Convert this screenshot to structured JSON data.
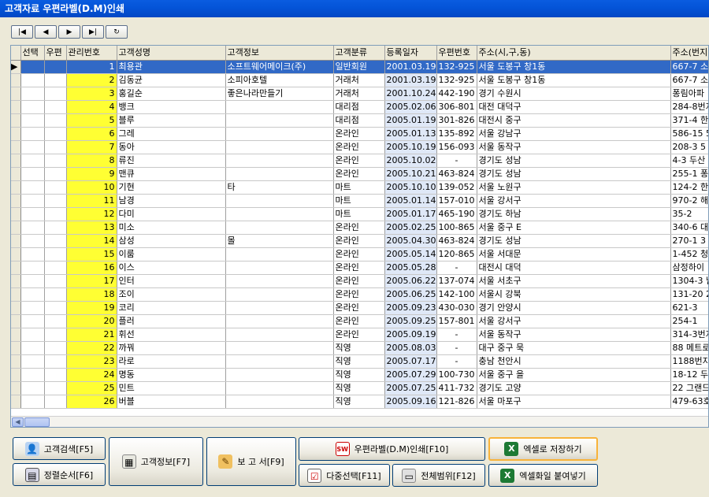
{
  "window": {
    "title": "고객자료 우편라벨(D.M)인쇄"
  },
  "navigator": [
    "|◀",
    "◀",
    "▶",
    "▶|",
    "↻"
  ],
  "grid": {
    "columns": [
      "선택",
      "우편",
      "관리번호",
      "고객성명",
      "고객정보",
      "고객분류",
      "등록일자",
      "우편번호",
      "주소(시,구,동)",
      "주소(번지"
    ],
    "rows": [
      [
        "",
        "",
        "1",
        "최용관",
        "소프트웨어메이크(주)",
        "일반회원",
        "2001.03.19",
        "132-925",
        "서울 도봉구 창1동",
        "667-7 소"
      ],
      [
        "",
        "",
        "2",
        "김동균",
        "소피아호텔",
        "거래처",
        "2001.03.19",
        "132-925",
        "서울 도봉구 창1동",
        "667-7 소"
      ],
      [
        "",
        "",
        "3",
        "홍길순",
        "좋은나라만들기",
        "거래처",
        "2001.10.24",
        "442-190",
        "경기 수원시",
        "퐁림아파"
      ],
      [
        "",
        "",
        "4",
        "뱅크",
        "",
        "대리점",
        "2005.02.06",
        "306-801",
        "대전 대덕구",
        "284-8번지"
      ],
      [
        "",
        "",
        "5",
        "블루",
        "",
        "대리점",
        "2005.01.19",
        "301-826",
        "대전시 중구",
        "371-4 한"
      ],
      [
        "",
        "",
        "6",
        "그레",
        "",
        "온라인",
        "2005.01.13",
        "135-892",
        "서울 강남구",
        "586-15 5"
      ],
      [
        "",
        "",
        "7",
        "동아",
        "",
        "온라인",
        "2005.10.19",
        "156-093",
        "서울 동작구",
        "208-3 5"
      ],
      [
        "",
        "",
        "8",
        "류진",
        "",
        "온라인",
        "2005.10.02",
        "-",
        "경기도 성남",
        "4-3 두산"
      ],
      [
        "",
        "",
        "9",
        "맨큐",
        "",
        "온라인",
        "2005.10.21",
        "463-824",
        "경기도 성남",
        "255-1 퐁"
      ],
      [
        "",
        "",
        "10",
        "기현",
        "타",
        "마트",
        "2005.10.10",
        "139-052",
        "서울 노원구",
        "124-2 한"
      ],
      [
        "",
        "",
        "11",
        "남경",
        "",
        "마트",
        "2005.01.14",
        "157-010",
        "서울 강서구",
        "970-2 해"
      ],
      [
        "",
        "",
        "12",
        "다미",
        "",
        "마트",
        "2005.01.17",
        "465-190",
        "경기도 하남",
        "35-2"
      ],
      [
        "",
        "",
        "13",
        "미소",
        "",
        "온라인",
        "2005.02.25",
        "100-865",
        "서울 중구 E",
        "340-6 대"
      ],
      [
        "",
        "",
        "14",
        "삼성",
        "몰",
        "온라인",
        "2005.04.30",
        "463-824",
        "경기도 성남",
        "270-1 3"
      ],
      [
        "",
        "",
        "15",
        "이룸",
        "",
        "온라인",
        "2005.05.14",
        "120-865",
        "서울 서대문",
        "1-452 청"
      ],
      [
        "",
        "",
        "16",
        "이스",
        "",
        "온라인",
        "2005.05.28",
        "-",
        "대전시 대덕",
        "삼정하이"
      ],
      [
        "",
        "",
        "17",
        "인터",
        "",
        "온라인",
        "2005.06.22",
        "137-074",
        "서울 서초구",
        "1304-3 남"
      ],
      [
        "",
        "",
        "18",
        "조이",
        "",
        "온라인",
        "2005.06.25",
        "142-100",
        "서울시 강북",
        "131-20 2"
      ],
      [
        "",
        "",
        "19",
        "코리",
        "",
        "온라인",
        "2005.09.23",
        "430-030",
        "경기 안양시",
        "621-3"
      ],
      [
        "",
        "",
        "20",
        "플러",
        "",
        "온라인",
        "2005.09.25",
        "157-801",
        "서울 강서구",
        "254-1"
      ],
      [
        "",
        "",
        "21",
        "휘선",
        "",
        "온라인",
        "2005.09.19",
        "-",
        "서울 동작구",
        "314-3번지"
      ],
      [
        "",
        "",
        "22",
        "까꿔",
        "",
        "직영",
        "2005.08.03",
        "-",
        "대구 중구 묵",
        "88 메트로"
      ],
      [
        "",
        "",
        "23",
        "라로",
        "",
        "직영",
        "2005.07.17",
        "-",
        "충남 천안시",
        "1188번지"
      ],
      [
        "",
        "",
        "24",
        "명동",
        "",
        "직영",
        "2005.07.29",
        "100-730",
        "서울 중구 을",
        "18-12 두"
      ],
      [
        "",
        "",
        "25",
        "민트",
        "",
        "직영",
        "2005.07.25",
        "411-732",
        "경기도 고양",
        "22 그랜드"
      ],
      [
        "",
        "",
        "26",
        "버블",
        "",
        "직영",
        "2005.09.16",
        "121-826",
        "서울 마포구",
        "479-63호"
      ]
    ]
  },
  "buttons": {
    "customer_search": "고객검색[F5]",
    "sort_order": "정렬순서[F6]",
    "customer_info": "고객정보[F7]",
    "report": "보 고 서[F9]",
    "print_label": "우편라벨(D.M)인쇄[F10]",
    "multi_select": "다중선택[F11]",
    "full_range": "전체범위[F12]",
    "excel_save": "엑셀로 저장하기",
    "excel_paste": "엑셀화일 붙여넣기"
  }
}
